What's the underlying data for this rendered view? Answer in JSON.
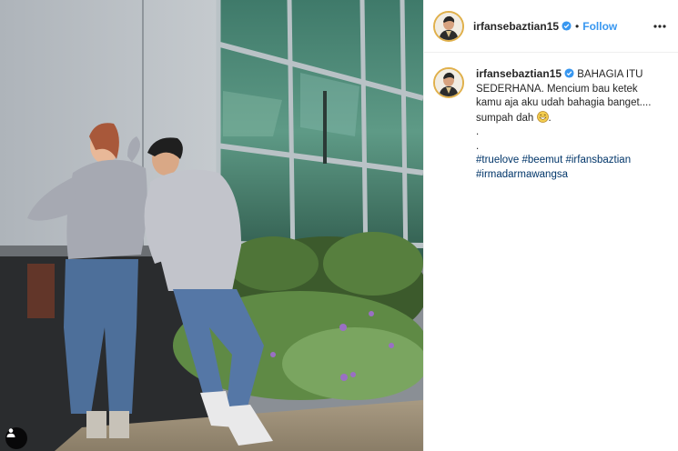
{
  "post": {
    "username": "irfansebaztian15",
    "follow_label": "Follow",
    "separator": "•",
    "caption_text": "BAHAGIA ITU SEDERHANA. Mencium bau ketek kamu aja aku udah bahagia banget.... sumpah dah",
    "caption_end": ".",
    "caption_dots": [
      ".",
      "."
    ],
    "hashtags": [
      "#truelove",
      "#beemut",
      "#irfansbaztian",
      "#irmadarmawangsa"
    ]
  },
  "icons": {
    "verified": "verified-badge-icon",
    "more": "more-options-icon",
    "user_tag": "user-tag-icon",
    "emoji": "grinning-sweat-emoji"
  },
  "colors": {
    "link": "#3897f0",
    "hashtag": "#003569",
    "avatar_ring": "#e0b04b"
  }
}
